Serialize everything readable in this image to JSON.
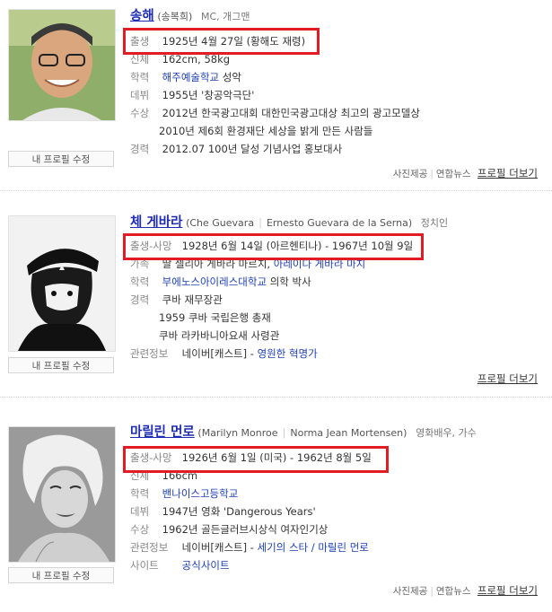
{
  "people": [
    {
      "name": "송해",
      "sub": "(송복희)",
      "job": "MC, 개그맨",
      "birth_label": "출생",
      "birth_value": "1925년 4월 27일 (황해도 재령)",
      "rows": [
        {
          "label": "신체",
          "value": "162cm, 58kg"
        },
        {
          "label": "학력",
          "link": "해주예술학교",
          "value": " 성악"
        },
        {
          "label": "데뷔",
          "value": "1955년 '창공악극단'"
        },
        {
          "label": "수상",
          "value": "2012년 한국광고대회 대한민국광고대상 최고의 광고모델상"
        },
        {
          "label": "",
          "value": "2010년 제6회 환경재단 세상을 밝게 만든 사람들"
        },
        {
          "label": "경력",
          "value": "2012.07 100년 달성 기념사업 홍보대사"
        }
      ],
      "edit": "내 프로필 수정",
      "footer": {
        "photo": "사진제공",
        "source": "연합뉴스",
        "more": "프로필 더보기"
      }
    },
    {
      "name": "체 게바라",
      "sub": "(Che Guevara",
      "sub2": "Ernesto Guevara de la Serna)",
      "job": "정치인",
      "birth_label": "출생-사망",
      "birth_value": "1928년 6월 14일 (아르헨티나) - 1967년 10월 9일",
      "family_label": "가족",
      "family_value": "딸 셀리아 게바라 마르치, ",
      "family_link": "아레이다 게바라 마치",
      "edu_label": "학력",
      "edu_link": "부에노스아이레스대학교",
      "edu_value": " 의학 박사",
      "career_label": "경력",
      "career": [
        "쿠바 재무장관",
        "1959 쿠바 국립은행 총재",
        "쿠바 라카바니아요새 사령관"
      ],
      "related_label": "관련정보",
      "related_value": "네이버[캐스트] - ",
      "related_link": "영원한 혁명가",
      "edit": "내 프로필 수정",
      "footer": {
        "more": "프로필 더보기"
      }
    },
    {
      "name": "마릴린 먼로",
      "sub": "(Marilyn Monroe",
      "sub2": "Norma Jean Mortensen)",
      "job": "영화배우, 가수",
      "birth_label": "출생-사망",
      "birth_value": "1926년 6월 1일 (미국) - 1962년 8월 5일",
      "body_label": "신체",
      "body_value": "166cm",
      "edu_label": "학력",
      "edu_link": "밴나이스고등학교",
      "debut_label": "데뷔",
      "debut_value": "1947년 영화 'Dangerous Years'",
      "award_label": "수상",
      "award_value": "1962년 골든글러브시상식 여자인기상",
      "related_label": "관련정보",
      "related_value": "네이버[캐스트] - ",
      "related_link": "세기의 스타 / 마릴린 먼로",
      "site_label": "사이트",
      "site_link": "공식사이트",
      "edit": "내 프로필 수정",
      "footer": {
        "photo": "사진제공",
        "source": "연합뉴스",
        "more": "프로필 더보기"
      }
    }
  ],
  "colors": {
    "highlight": "#e21c25",
    "name": "#1d2bb5",
    "link": "#1d3fb5"
  }
}
